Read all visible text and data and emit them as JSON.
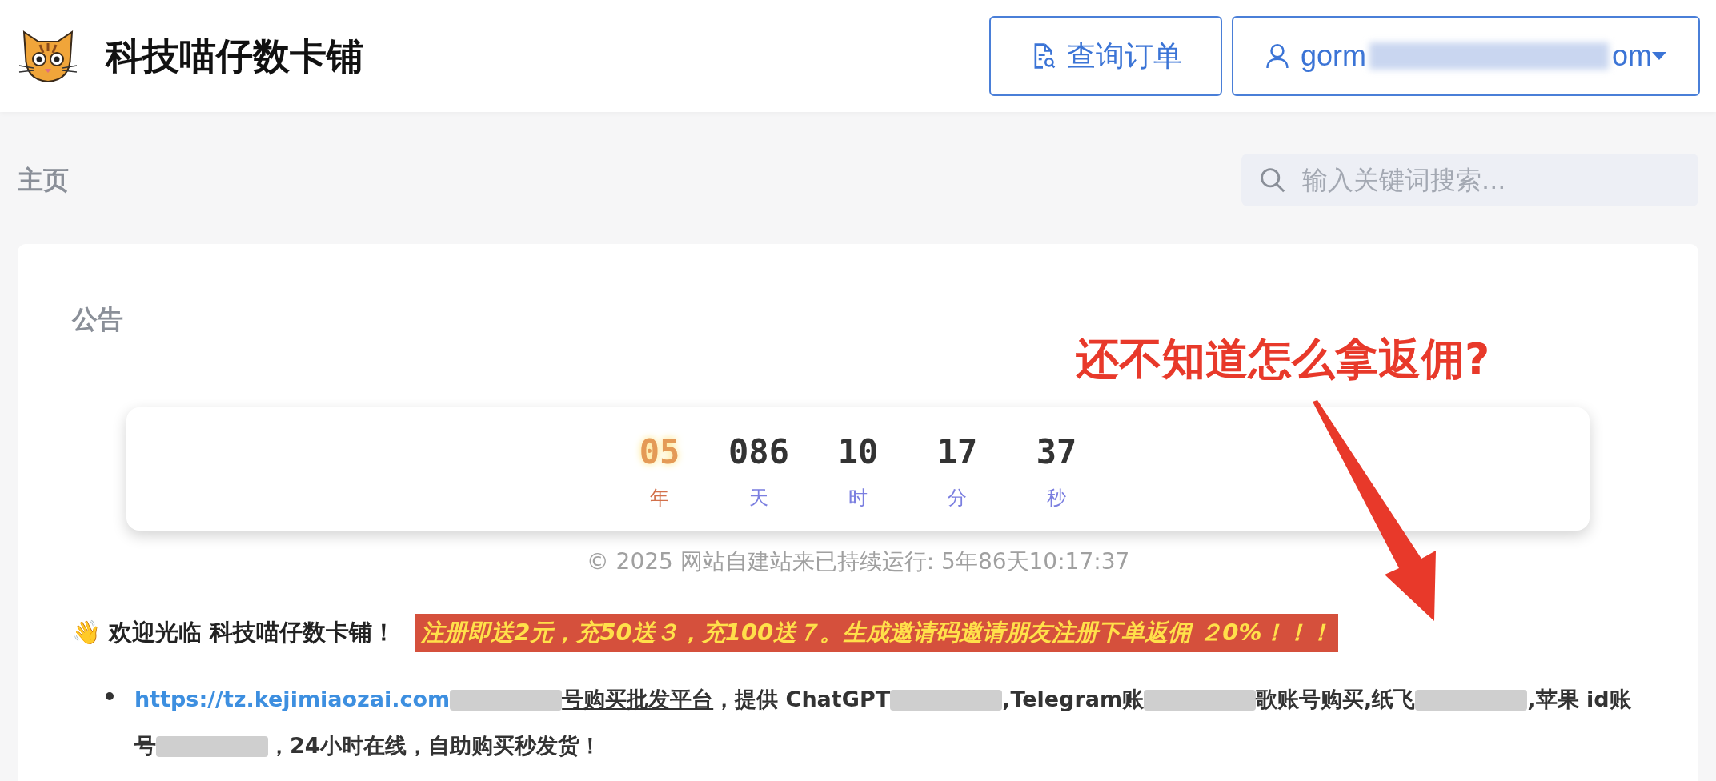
{
  "header": {
    "title": "科技喵仔数卡铺",
    "order_button": "查询订单",
    "account": {
      "email_start": "gorm",
      "email_end": "om"
    }
  },
  "breadcrumb": "主页",
  "search": {
    "placeholder": "输入关键词搜索..."
  },
  "notice": {
    "title": "公告",
    "annotation": "还不知道怎么拿返佣?",
    "countdown": [
      {
        "value": "05",
        "unit": "年",
        "kind": "year"
      },
      {
        "value": "086",
        "unit": "天",
        "kind": "unit"
      },
      {
        "value": "10",
        "unit": "时",
        "kind": "unit"
      },
      {
        "value": "17",
        "unit": "分",
        "kind": "unit"
      },
      {
        "value": "37",
        "unit": "秒",
        "kind": "unit"
      }
    ],
    "uptime": "© 2025 网站自建站来已持续运行: 5年86天10:17:37",
    "welcome": "👋 欢迎光临 科技喵仔数卡铺！",
    "promo": "注册即送2元，充50送３，充100送７。生成邀请码邀请朋友注册下单返佣 ２0%！！！",
    "bullet": [
      {
        "kind": "link",
        "text": "https://tz.kejimiaozai.com"
      },
      {
        "kind": "redacted"
      },
      {
        "kind": "underline",
        "text": "号购买批发平台"
      },
      {
        "kind": "text",
        "text": "，提供 ChatGPT"
      },
      {
        "kind": "redacted"
      },
      {
        "kind": "text",
        "text": ",Telegram账"
      },
      {
        "kind": "redacted"
      },
      {
        "kind": "text",
        "text": "歌账号购买,纸飞"
      },
      {
        "kind": "redacted"
      },
      {
        "kind": "text",
        "text": ",苹果 id账号"
      },
      {
        "kind": "redacted"
      },
      {
        "kind": "text",
        "text": "，24小时在线，自助购买秒发货！"
      }
    ]
  }
}
